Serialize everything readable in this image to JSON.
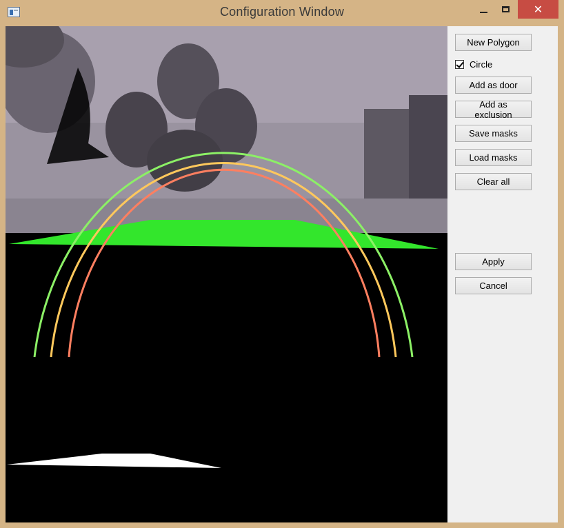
{
  "window": {
    "title": "Configuration Window",
    "controls": {
      "minimize": "minimize-icon",
      "maximize": "maximize-icon",
      "close": "✕"
    }
  },
  "panel": {
    "new_polygon": "New Polygon",
    "circle_label": "Circle",
    "circle_checked": true,
    "add_door": "Add as door",
    "add_exclusion": "Add as exclusion",
    "save_masks": "Save masks",
    "load_masks": "Load masks",
    "clear_all": "Clear all",
    "apply": "Apply",
    "cancel": "Cancel"
  },
  "colors": {
    "ring_outer": "#8cf066",
    "ring_middle": "#ffc85c",
    "ring_inner": "#ff7f60",
    "floor_polygon": "#33e62c",
    "door_polygon": "#ffffff",
    "close_button": "#c74c43"
  }
}
